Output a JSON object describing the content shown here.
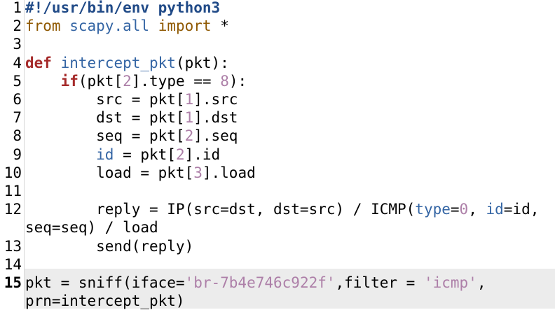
{
  "editor": {
    "current_line": "15",
    "lines": [
      {
        "n": "1",
        "t": [
          {
            "c": "sh",
            "v": "#!/usr/bin/env python3"
          }
        ]
      },
      {
        "n": "2",
        "t": [
          {
            "c": "kw2",
            "v": "from"
          },
          {
            "c": "",
            "v": " "
          },
          {
            "c": "id",
            "v": "scapy.all"
          },
          {
            "c": "",
            "v": " "
          },
          {
            "c": "kw2",
            "v": "import"
          },
          {
            "c": "",
            "v": " *"
          }
        ]
      },
      {
        "n": "3",
        "t": []
      },
      {
        "n": "4",
        "t": [
          {
            "c": "kw",
            "v": "def"
          },
          {
            "c": "",
            "v": " "
          },
          {
            "c": "id",
            "v": "intercept_pkt"
          },
          {
            "c": "",
            "v": "(pkt):"
          }
        ]
      },
      {
        "n": "5",
        "t": [
          {
            "c": "",
            "v": "    "
          },
          {
            "c": "kw",
            "v": "if"
          },
          {
            "c": "",
            "v": "(pkt["
          },
          {
            "c": "num",
            "v": "2"
          },
          {
            "c": "",
            "v": "].type == "
          },
          {
            "c": "num",
            "v": "8"
          },
          {
            "c": "",
            "v": "):"
          }
        ]
      },
      {
        "n": "6",
        "t": [
          {
            "c": "",
            "v": "        src = pkt["
          },
          {
            "c": "num",
            "v": "1"
          },
          {
            "c": "",
            "v": "].src"
          }
        ]
      },
      {
        "n": "7",
        "t": [
          {
            "c": "",
            "v": "        dst = pkt["
          },
          {
            "c": "num",
            "v": "1"
          },
          {
            "c": "",
            "v": "].dst"
          }
        ]
      },
      {
        "n": "8",
        "t": [
          {
            "c": "",
            "v": "        seq = pkt["
          },
          {
            "c": "num",
            "v": "2"
          },
          {
            "c": "",
            "v": "].seq"
          }
        ]
      },
      {
        "n": "9",
        "t": [
          {
            "c": "",
            "v": "        "
          },
          {
            "c": "id",
            "v": "id"
          },
          {
            "c": "",
            "v": " = pkt["
          },
          {
            "c": "num",
            "v": "2"
          },
          {
            "c": "",
            "v": "].id"
          }
        ]
      },
      {
        "n": "10",
        "t": [
          {
            "c": "",
            "v": "        load = pkt["
          },
          {
            "c": "num",
            "v": "3"
          },
          {
            "c": "",
            "v": "].load"
          }
        ]
      },
      {
        "n": "11",
        "t": []
      },
      {
        "n": "12",
        "t": [
          {
            "c": "",
            "v": "        reply = IP(src=dst, dst=src) / ICMP("
          },
          {
            "c": "id",
            "v": "type"
          },
          {
            "c": "",
            "v": "="
          },
          {
            "c": "num",
            "v": "0"
          },
          {
            "c": "",
            "v": ", "
          },
          {
            "c": "id",
            "v": "id"
          },
          {
            "c": "",
            "v": "=id,"
          }
        ]
      },
      {
        "n": "",
        "t": [
          {
            "c": "",
            "v": "seq=seq) / load"
          }
        ]
      },
      {
        "n": "13",
        "t": [
          {
            "c": "",
            "v": "        send(reply)"
          }
        ]
      },
      {
        "n": "14",
        "t": []
      },
      {
        "n": "15",
        "t": [
          {
            "c": "",
            "v": "pkt = sniff(iface="
          },
          {
            "c": "str",
            "v": "'br-7b4e746c922f'"
          },
          {
            "c": "",
            "v": ",filter = "
          },
          {
            "c": "str",
            "v": "'icmp'"
          },
          {
            "c": "",
            "v": ","
          }
        ]
      },
      {
        "n": "",
        "t": [
          {
            "c": "",
            "v": "prn=intercept_pkt)"
          }
        ]
      }
    ]
  },
  "colors": {
    "keyword": "#a52a2a",
    "import_keyword": "#8f5902",
    "identifier": "#3465a4",
    "number_string": "#ad7fa8",
    "shebang": "#204a87",
    "current_line_bg": "#ececec"
  }
}
